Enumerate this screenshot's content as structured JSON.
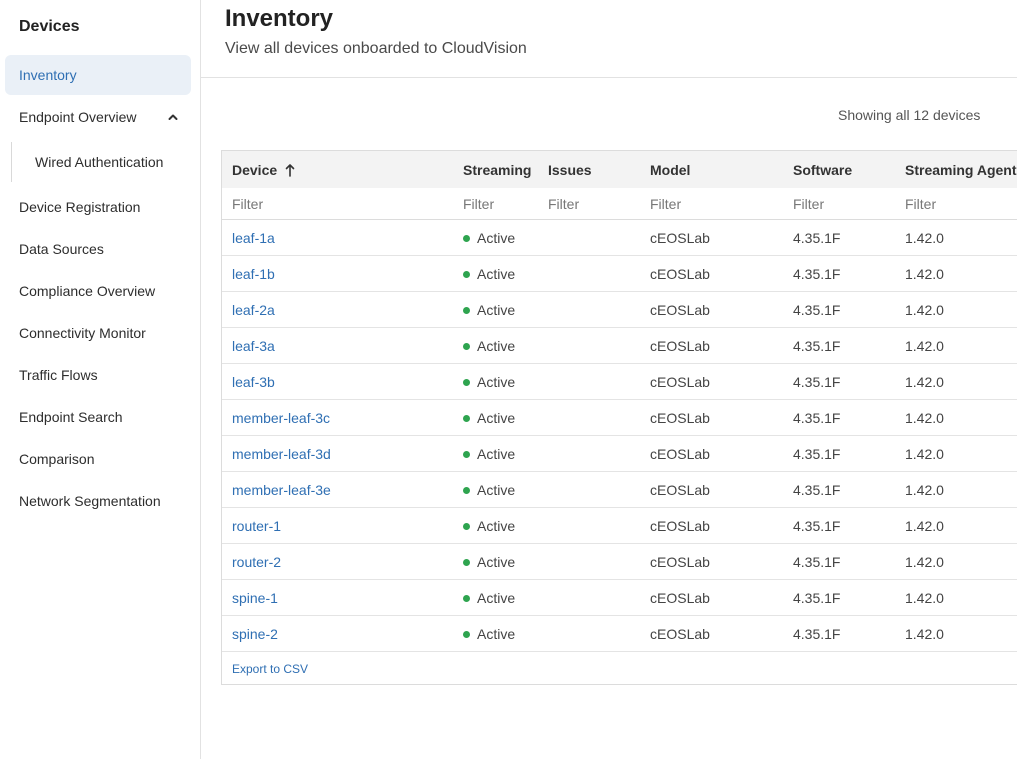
{
  "sidebar": {
    "heading": "Devices",
    "items": [
      {
        "label": "Inventory"
      },
      {
        "label": "Endpoint Overview"
      },
      {
        "label": "Wired Authentication"
      },
      {
        "label": "Device Registration"
      },
      {
        "label": "Data Sources"
      },
      {
        "label": "Compliance Overview"
      },
      {
        "label": "Connectivity Monitor"
      },
      {
        "label": "Traffic Flows"
      },
      {
        "label": "Endpoint Search"
      },
      {
        "label": "Comparison"
      },
      {
        "label": "Network Segmentation"
      }
    ]
  },
  "header": {
    "title": "Inventory",
    "subtitle": "View all devices onboarded to CloudVision"
  },
  "table": {
    "count_text": "Showing all 12 devices",
    "columns": [
      "Device",
      "Streaming",
      "Issues",
      "Model",
      "Software",
      "Streaming Agent"
    ],
    "sort_icon": "arrow-up-icon",
    "filter_placeholder": "Filter",
    "rows": [
      {
        "device": "leaf-1a",
        "streaming": "Active",
        "issues": "",
        "model": "cEOSLab",
        "software": "4.35.1F",
        "agent": "1.42.0"
      },
      {
        "device": "leaf-1b",
        "streaming": "Active",
        "issues": "",
        "model": "cEOSLab",
        "software": "4.35.1F",
        "agent": "1.42.0"
      },
      {
        "device": "leaf-2a",
        "streaming": "Active",
        "issues": "",
        "model": "cEOSLab",
        "software": "4.35.1F",
        "agent": "1.42.0"
      },
      {
        "device": "leaf-3a",
        "streaming": "Active",
        "issues": "",
        "model": "cEOSLab",
        "software": "4.35.1F",
        "agent": "1.42.0"
      },
      {
        "device": "leaf-3b",
        "streaming": "Active",
        "issues": "",
        "model": "cEOSLab",
        "software": "4.35.1F",
        "agent": "1.42.0"
      },
      {
        "device": "member-leaf-3c",
        "streaming": "Active",
        "issues": "",
        "model": "cEOSLab",
        "software": "4.35.1F",
        "agent": "1.42.0"
      },
      {
        "device": "member-leaf-3d",
        "streaming": "Active",
        "issues": "",
        "model": "cEOSLab",
        "software": "4.35.1F",
        "agent": "1.42.0"
      },
      {
        "device": "member-leaf-3e",
        "streaming": "Active",
        "issues": "",
        "model": "cEOSLab",
        "software": "4.35.1F",
        "agent": "1.42.0"
      },
      {
        "device": "router-1",
        "streaming": "Active",
        "issues": "",
        "model": "cEOSLab",
        "software": "4.35.1F",
        "agent": "1.42.0"
      },
      {
        "device": "router-2",
        "streaming": "Active",
        "issues": "",
        "model": "cEOSLab",
        "software": "4.35.1F",
        "agent": "1.42.0"
      },
      {
        "device": "spine-1",
        "streaming": "Active",
        "issues": "",
        "model": "cEOSLab",
        "software": "4.35.1F",
        "agent": "1.42.0"
      },
      {
        "device": "spine-2",
        "streaming": "Active",
        "issues": "",
        "model": "cEOSLab",
        "software": "4.35.1F",
        "agent": "1.42.0"
      }
    ],
    "export_label": "Export to CSV"
  },
  "colors": {
    "accent": "#2f6fb3",
    "active_bg": "#eaf0f7",
    "status_active": "#2ea44f"
  }
}
